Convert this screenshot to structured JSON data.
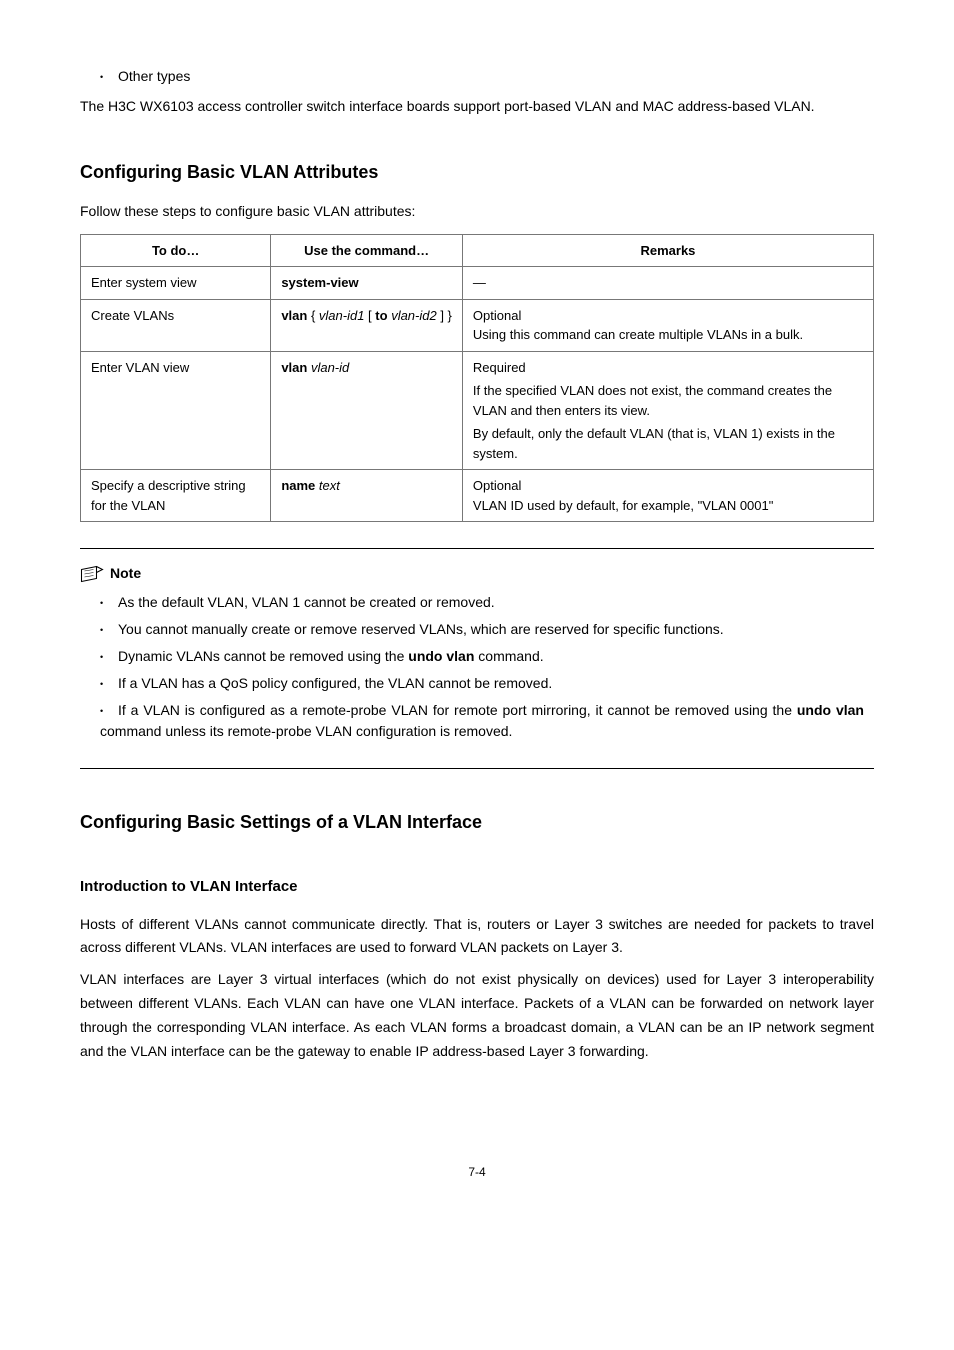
{
  "intro": {
    "bullet1": "Other types",
    "para1": "The H3C WX6103 access controller switch interface boards support port-based VLAN and MAC address-based VLAN."
  },
  "section1": {
    "heading": "Configuring Basic VLAN Attributes",
    "lead": "Follow these steps to configure basic VLAN attributes:",
    "th1": "To do…",
    "th2": "Use the command…",
    "th3": "Remarks",
    "r1c1": "Enter system view",
    "r1c2": "system-view",
    "r1c3": "—",
    "r2c1": "Create VLANs",
    "r2c2_p1": "vlan",
    "r2c2_p2": " { ",
    "r2c2_p3": "vlan-id1",
    "r2c2_p4": " [ ",
    "r2c2_p5": "to",
    "r2c2_p6": " ",
    "r2c2_p7": "vlan-id2",
    "r2c2_p8": " ] }",
    "r2c3l1": "Optional",
    "r2c3l2": "Using this command can create multiple VLANs in a bulk.",
    "r3c1": "Enter VLAN view",
    "r3c2_p1": "vlan",
    "r3c2_p2": " ",
    "r3c2_p3": "vlan-id",
    "r3c3l1": "Required",
    "r3c3l2": "If the specified VLAN does not exist, the command creates the VLAN and then enters its view.",
    "r3c3l3": "By default, only the default VLAN (that is, VLAN 1) exists in the system.",
    "r4c1": "Specify a descriptive string for the VLAN",
    "r4c2_p1": "name",
    "r4c2_p2": " ",
    "r4c2_p3": "text",
    "r4c3l1": "Optional",
    "r4c3l2": "VLAN ID used by default, for example, \"VLAN 0001\""
  },
  "note": {
    "label": "Note",
    "b1": "As the default VLAN, VLAN 1 cannot be created or removed.",
    "b2": "You cannot manually create or remove reserved VLANs, which are reserved for specific functions.",
    "b3a": "Dynamic VLANs cannot be removed using the ",
    "b3b": "undo vlan",
    "b3c": " command.",
    "b4": "If a VLAN has a QoS policy configured, the VLAN cannot be removed.",
    "b5a": "If a VLAN is configured as a remote-probe VLAN for remote port mirroring, it cannot be removed using the ",
    "b5b": "undo vlan",
    "b5c": " command unless its remote-probe VLAN configuration is removed."
  },
  "section2": {
    "heading": "Configuring Basic Settings of a VLAN Interface",
    "subhead": "Introduction to VLAN Interface",
    "para1": "Hosts of different VLANs cannot communicate directly. That is, routers or Layer 3 switches are needed for packets to travel across different VLANs. VLAN interfaces are used to forward VLAN packets on Layer 3.",
    "para2": "VLAN interfaces are Layer 3 virtual interfaces (which do not exist physically on devices) used for Layer 3 interoperability between different VLANs. Each VLAN can have one VLAN interface. Packets of a VLAN can be forwarded on network layer through the corresponding VLAN interface. As each VLAN forms a broadcast domain, a VLAN can be an IP network segment and the VLAN interface can be the gateway to enable IP address-based Layer 3 forwarding."
  },
  "footer": "7-4"
}
